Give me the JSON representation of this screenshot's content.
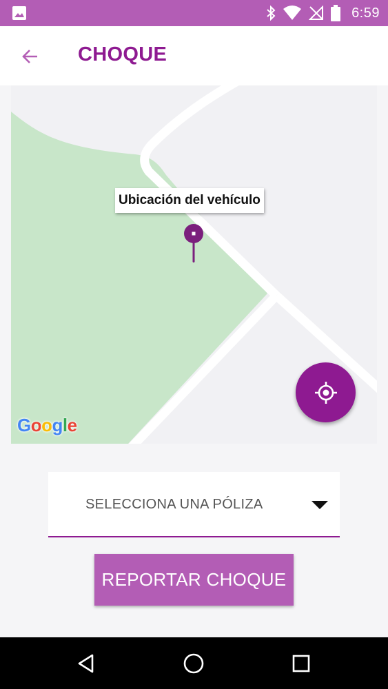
{
  "status_bar": {
    "time": "6:59",
    "icons": [
      "image-icon",
      "bluetooth-icon",
      "wifi-icon",
      "no-signal-icon",
      "battery-icon"
    ]
  },
  "app_bar": {
    "title": "CHOQUE",
    "back_icon": "arrow-left-icon"
  },
  "map": {
    "marker_label": "Ubicación del vehículo",
    "logo_letters": [
      "G",
      "o",
      "o",
      "g",
      "l",
      "e"
    ],
    "logo_colors": [
      "#4285F4",
      "#EA4335",
      "#FBBC05",
      "#4285F4",
      "#34A853",
      "#EA4335"
    ],
    "park_color": "#c8e6c9",
    "road_color": "#ffffff",
    "locate_icon": "my-location-icon"
  },
  "policy_select": {
    "placeholder": "SELECCIONA UNA PÓLIZA"
  },
  "report_button": {
    "label": "REPORTAR CHOQUE"
  },
  "colors": {
    "accent": "#8e1a91",
    "primary_light": "#b35db5"
  },
  "nav_bar": {
    "icons": [
      "back-triangle-icon",
      "home-circle-icon",
      "recents-square-icon"
    ]
  }
}
